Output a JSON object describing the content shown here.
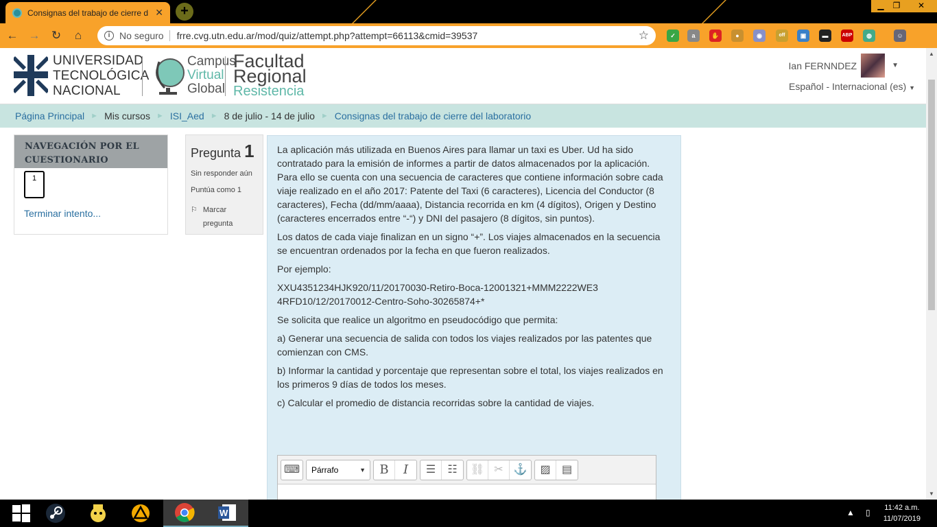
{
  "browser": {
    "tab_title": "Consignas del trabajo de cierre d",
    "security_label": "No seguro",
    "url": "frre.cvg.utn.edu.ar/mod/quiz/attempt.php?attempt=66113&cmid=39537",
    "extensions": [
      {
        "name": "check-badge",
        "color": "#3aa645",
        "text": "✓"
      },
      {
        "name": "a-ext",
        "color": "#888888",
        "text": "a"
      },
      {
        "name": "hand-ext",
        "color": "#d22",
        "text": "✋"
      },
      {
        "name": "cookie-ext",
        "color": "#c89030",
        "text": "●"
      },
      {
        "name": "discord-ext",
        "color": "#8890c8",
        "text": "◉"
      },
      {
        "name": "off-ext",
        "color": "#c8a030",
        "text": "off"
      },
      {
        "name": "photo-ext",
        "color": "#3a80c8",
        "text": "▣"
      },
      {
        "name": "card-ext",
        "color": "#222",
        "text": "▬"
      },
      {
        "name": "abp-ext",
        "color": "#c00",
        "text": "ABP"
      },
      {
        "name": "globe-ext",
        "color": "#4a8",
        "text": "◍"
      },
      {
        "name": "profile-ext",
        "color": "#667",
        "text": "☺"
      }
    ],
    "ext_badge": "0"
  },
  "header": {
    "utn_lines": [
      "UNIVERSIDAD",
      "TECNOLÓGICA",
      "NACIONAL"
    ],
    "cvg_lines": [
      "Campus",
      "Virtual",
      "Global"
    ],
    "frr_lines": [
      "Facultad",
      "Regional",
      "Resistencia"
    ],
    "user_name": "Ian FERNNDEZ",
    "language": "Español - Internacional (es)"
  },
  "breadcrumb": [
    {
      "label": "Página Principal",
      "link": true
    },
    {
      "label": "Mis cursos",
      "link": false
    },
    {
      "label": "ISI_Aed",
      "link": true
    },
    {
      "label": "8 de julio - 14 de julio",
      "link": false
    },
    {
      "label": "Consignas del trabajo de cierre del laboratorio",
      "link": true
    }
  ],
  "quiz_nav": {
    "title": "NAVEGACIÓN POR EL CUESTIONARIO",
    "question_button": "1",
    "finish_link": "Terminar intento..."
  },
  "question_info": {
    "label": "Pregunta",
    "number": "1",
    "status": "Sin responder aún",
    "score": "Puntúa como 1",
    "flag_label": "Marcar pregunta"
  },
  "question_text": {
    "paragraphs": [
      "La aplicación más utilizada en Buenos Aires para llamar un taxi es Uber. Ud ha sido contratado para la emisión de informes a partir de datos almacenados por la aplicación. Para ello se cuenta con una secuencia de caracteres que contiene información sobre cada viaje realizado en el año 2017: Patente del Taxi (6 caracteres), Licencia del Conductor (8 caracteres), Fecha (dd/mm/aaaa), Distancia recorrida en km (4 dígitos), Origen y Destino (caracteres encerrados entre “-“) y DNI del pasajero (8 dígitos, sin puntos).",
      "Los datos de cada viaje finalizan en un signo “+”. Los viajes almacenados en la secuencia  se encuentran ordenados por la fecha en que fueron realizados.",
      "Por ejemplo:",
      "XXU4351234HJK920/11/20170030-Retiro-Boca-12001321+MMM2222WE34RFD10/12/20170012-Centro-Soho-30265874+*",
      "Se solicita que realice un algoritmo en pseudocódigo que permita:",
      "a) Generar una secuencia de salida con todos los viajes realizados por las patentes que comienzan con CMS.",
      "b) Informar la cantidad y porcentaje que representan sobre el total, los viajes realizados en los primeros 9 días de todos los meses.",
      "c) Calcular el promedio de distancia recorridas sobre la cantidad de viajes."
    ]
  },
  "editor": {
    "format_select": "Párrafo"
  },
  "taskbar": {
    "time": "11:42 a.m.",
    "date": "11/07/2019"
  }
}
